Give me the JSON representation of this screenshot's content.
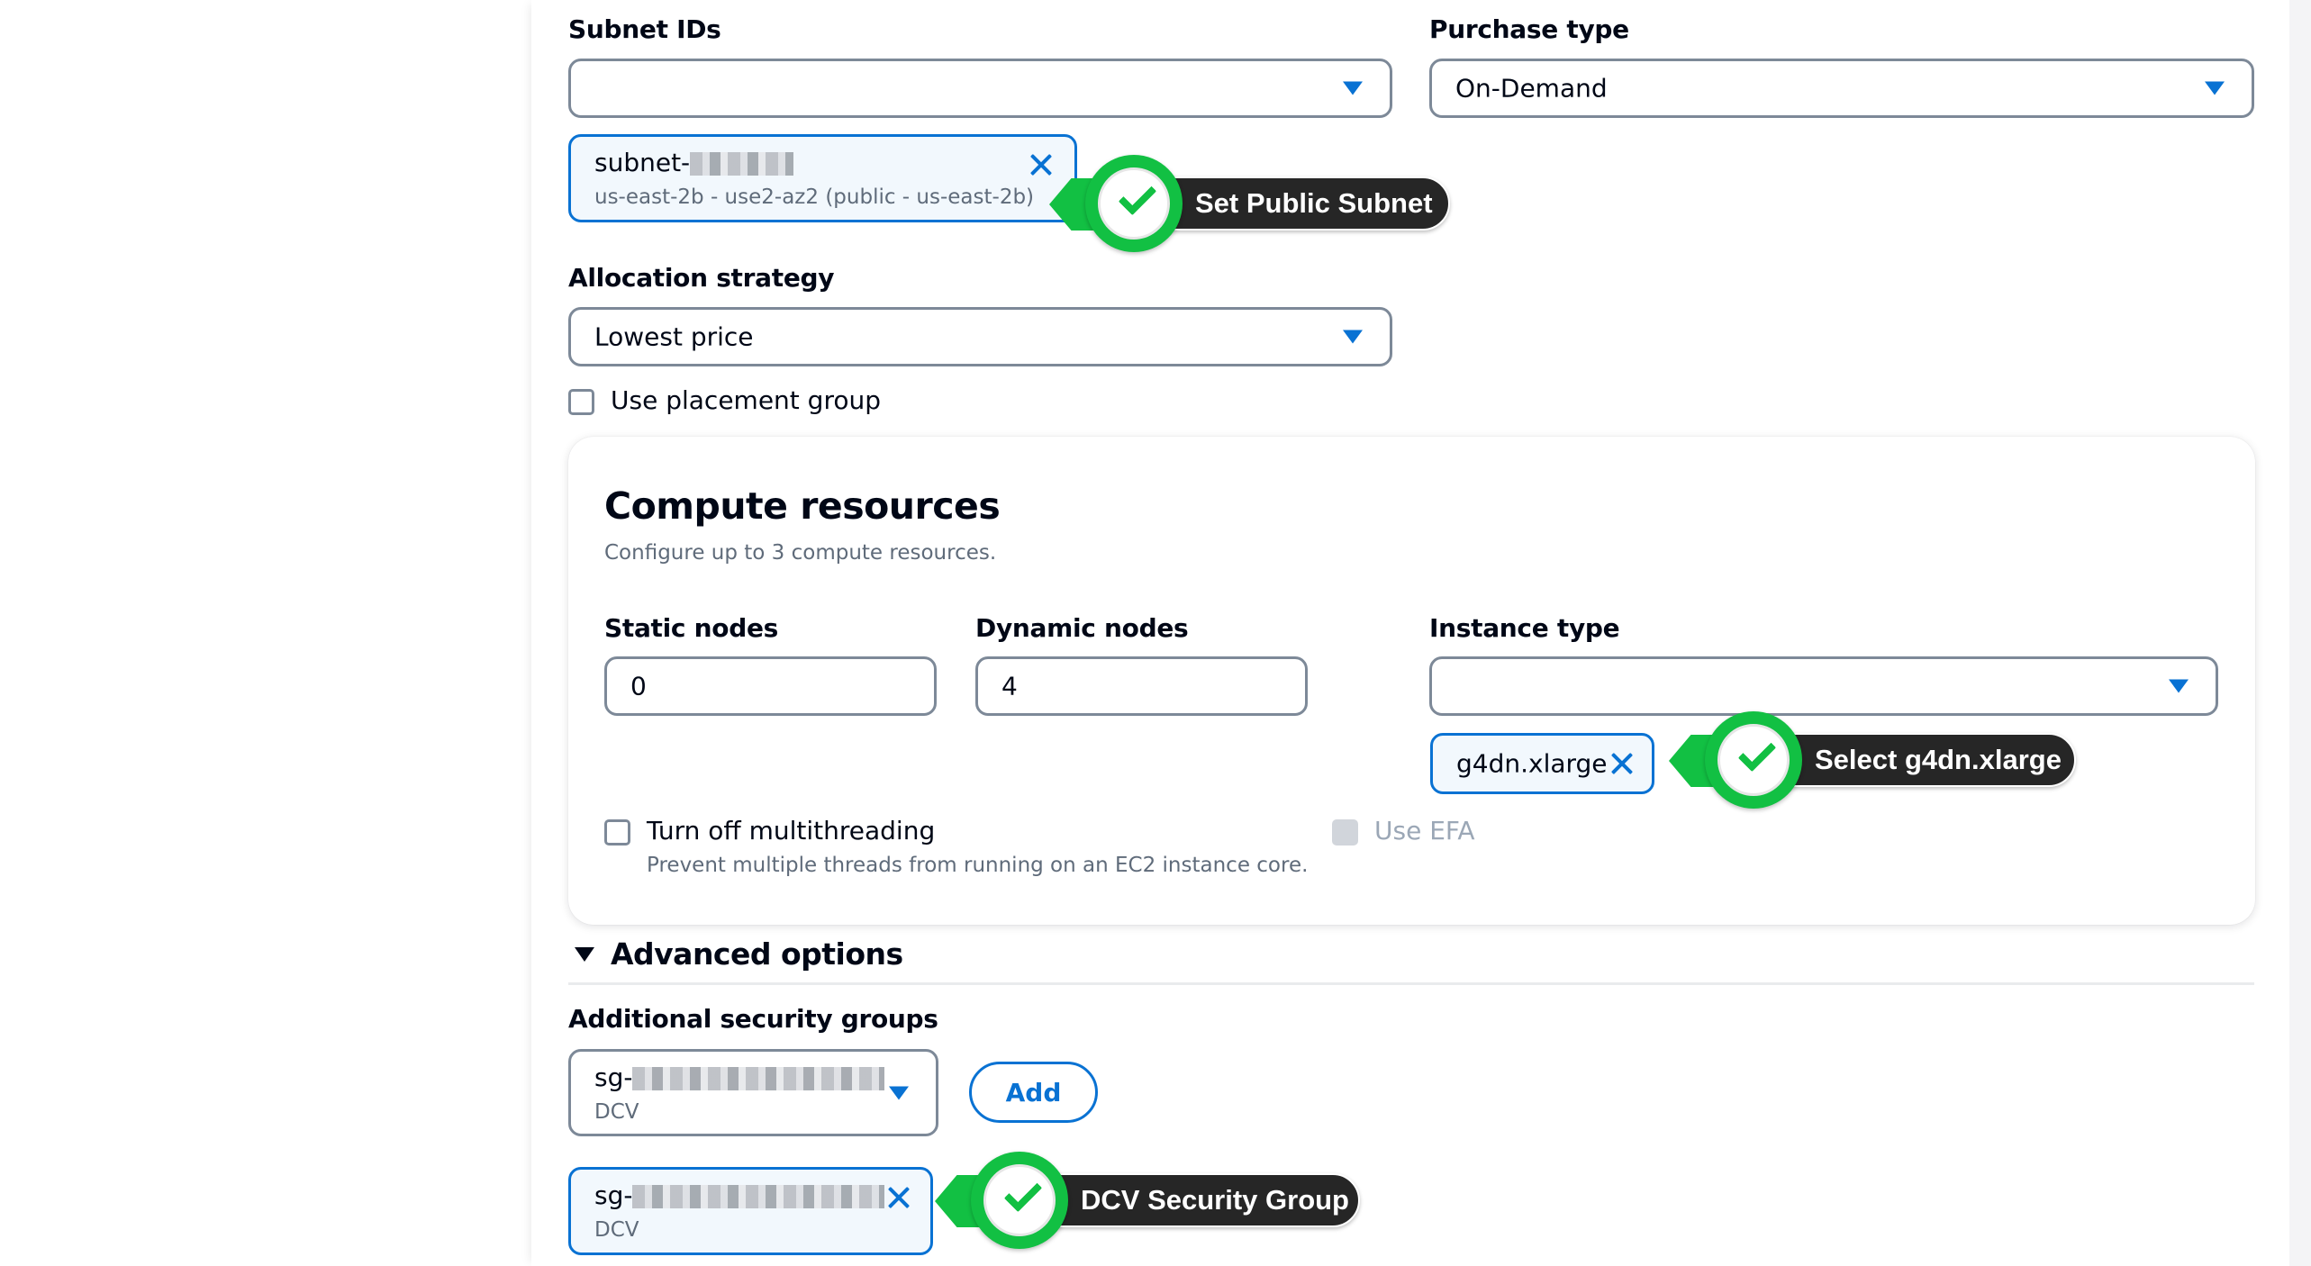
{
  "network": {
    "subnet_ids": {
      "label": "Subnet IDs",
      "value": "",
      "selected_token": {
        "id_prefix": "subnet-",
        "id_redacted": true,
        "description": "us-east-2b - use2-az2 (public - us-east-2b)"
      }
    },
    "purchase_type": {
      "label": "Purchase type",
      "value": "On-Demand"
    },
    "allocation_strategy": {
      "label": "Allocation strategy",
      "value": "Lowest price"
    },
    "placement_group": {
      "label": "Use placement group",
      "checked": false
    }
  },
  "compute_resources": {
    "title": "Compute resources",
    "description": "Configure up to 3 compute resources.",
    "static_nodes": {
      "label": "Static nodes",
      "value": "0"
    },
    "dynamic_nodes": {
      "label": "Dynamic nodes",
      "value": "4"
    },
    "instance_type": {
      "label": "Instance type",
      "value": "",
      "selected_token": "g4dn.xlarge"
    },
    "multithreading": {
      "label": "Turn off multithreading",
      "description": "Prevent multiple threads from running on an EC2 instance core.",
      "checked": false
    },
    "efa": {
      "label": "Use EFA",
      "checked": false,
      "disabled": true
    }
  },
  "advanced_options": {
    "title": "Advanced options",
    "expanded": true,
    "additional_security_groups": {
      "label": "Additional security groups",
      "dropdown": {
        "id_prefix": "sg-",
        "id_redacted": true,
        "description": "DCV"
      },
      "add_button": "Add",
      "selected_token": {
        "id_prefix": "sg-",
        "id_redacted": true,
        "description": "DCV"
      }
    }
  },
  "annotations": [
    {
      "text": "Set Public Subnet"
    },
    {
      "text": "Select g4dn.xlarge"
    },
    {
      "text": "DCV Security Group"
    }
  ],
  "colors": {
    "accent": "#0972d3",
    "annotation_green": "#12c043",
    "annotation_dark": "#262626",
    "field_border": "#7d8998"
  }
}
